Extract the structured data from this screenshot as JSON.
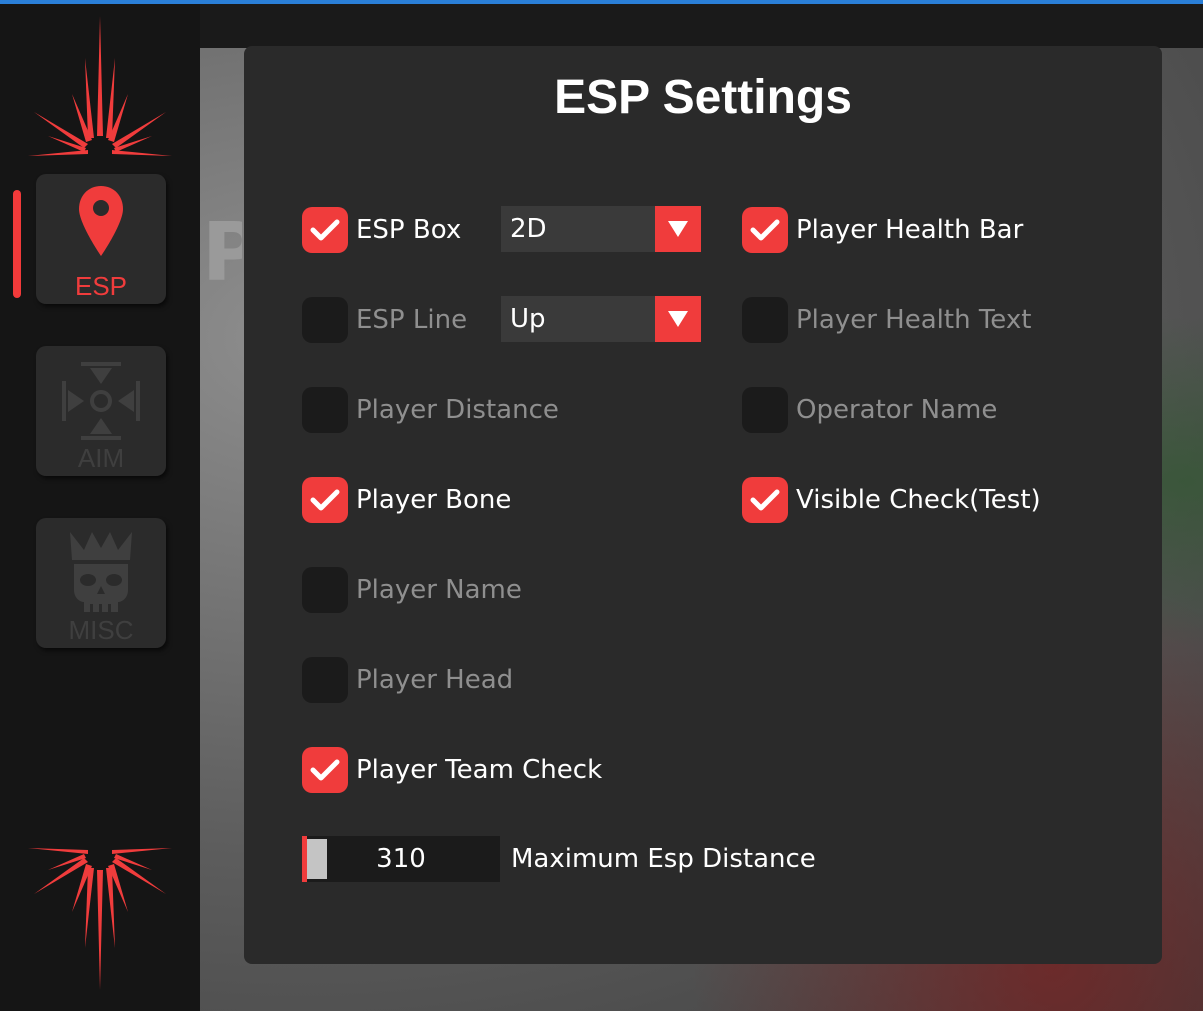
{
  "sidebar": {
    "items": [
      {
        "label": "ESP",
        "icon": "map-pin-icon",
        "active": true
      },
      {
        "label": "AIM",
        "icon": "crosshair-icon",
        "active": false
      },
      {
        "label": "MISC",
        "icon": "crowned-skull-icon",
        "active": false
      }
    ]
  },
  "colors": {
    "accent": "#f03c3c",
    "panel": "#2a2a2a",
    "checkbox_off": "#1b1b1b"
  },
  "panel": {
    "title": "ESP Settings",
    "options": {
      "esp_box": {
        "label": "ESP Box",
        "checked": true
      },
      "esp_line": {
        "label": "ESP Line",
        "checked": false
      },
      "player_distance": {
        "label": "Player Distance",
        "checked": false
      },
      "player_bone": {
        "label": "Player Bone",
        "checked": true
      },
      "player_name": {
        "label": "Player Name",
        "checked": false
      },
      "player_head": {
        "label": "Player Head",
        "checked": false
      },
      "player_team_check": {
        "label": "Player Team Check",
        "checked": true
      },
      "player_health_bar": {
        "label": "Player Health Bar",
        "checked": true
      },
      "player_health_text": {
        "label": "Player Health Text",
        "checked": false
      },
      "operator_name": {
        "label": "Operator Name",
        "checked": false
      },
      "visible_check": {
        "label": "Visible Check(Test)",
        "checked": true
      }
    },
    "box_type": {
      "value": "2D"
    },
    "line_position": {
      "value": "Up"
    },
    "max_distance": {
      "value": "310",
      "label": "Maximum Esp Distance"
    }
  }
}
